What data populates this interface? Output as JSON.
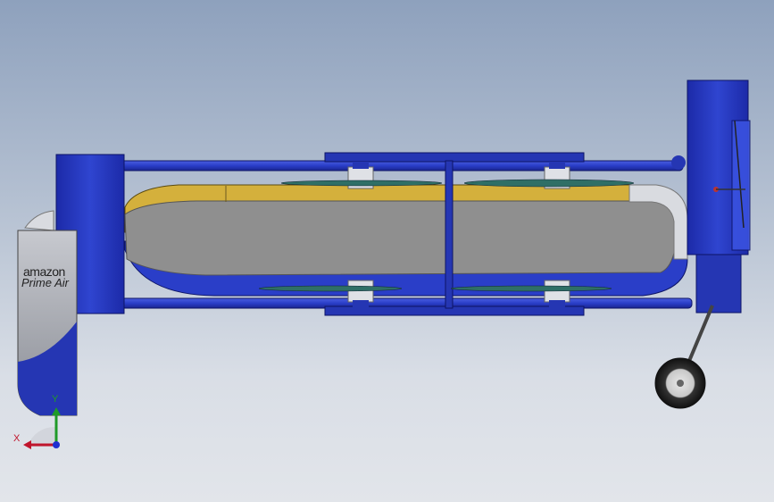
{
  "branding": {
    "line1": "amazon",
    "line2": "Prime Air"
  },
  "triad": {
    "x_label": "X",
    "y_label": "Y"
  },
  "colors": {
    "frame_blue": "#2536b3",
    "body_blue": "#2a3ec8",
    "stripe_yellow": "#d4b03c",
    "fuselage_gray": "#8f8f8f",
    "x_axis": "#c0152c",
    "y_axis": "#1f9a28",
    "z_axis": "#1f2fd0"
  }
}
